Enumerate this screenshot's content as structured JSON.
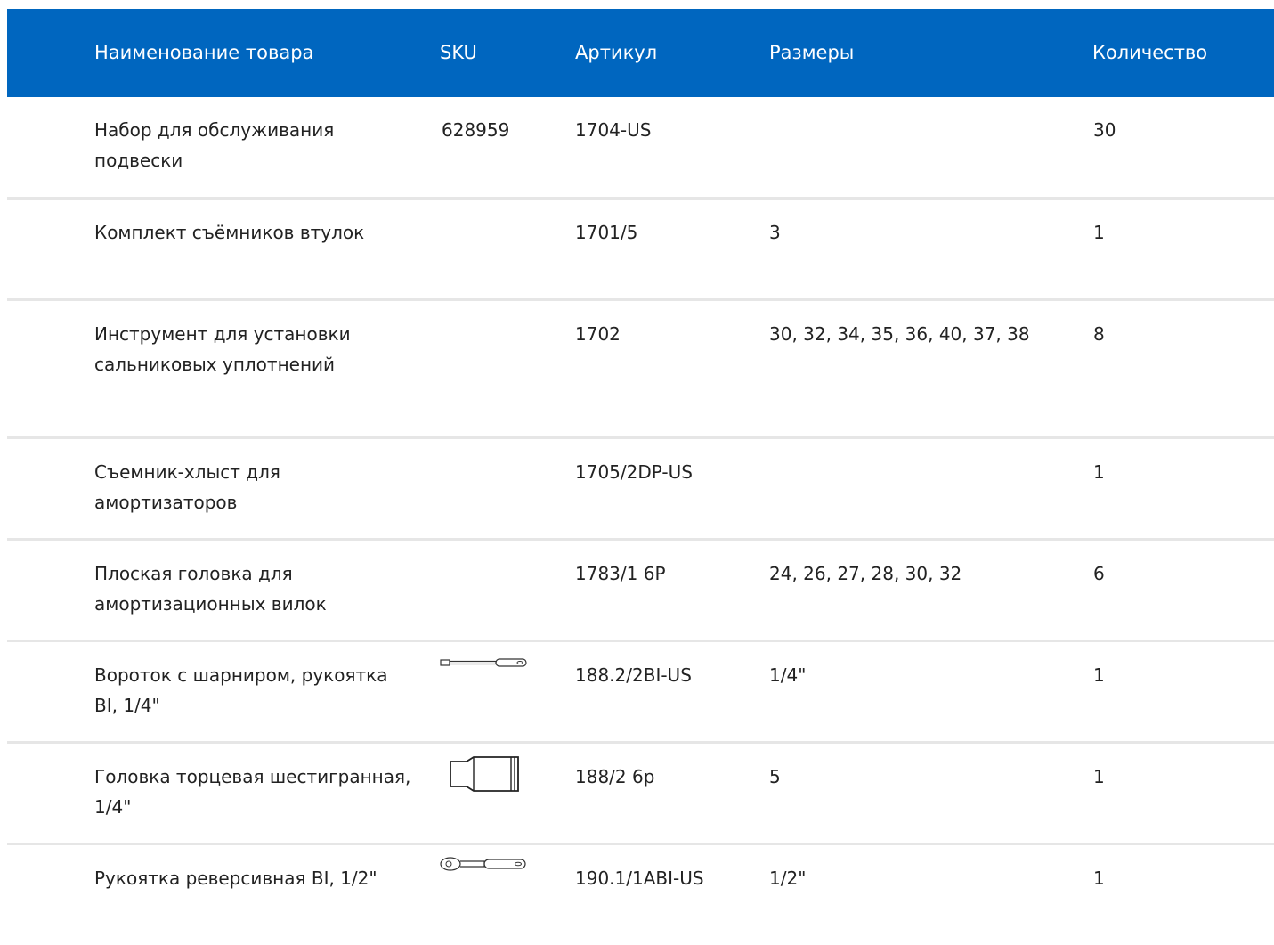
{
  "table": {
    "columns": {
      "name": "Наименование товара",
      "sku": "SKU",
      "article": "Артикул",
      "sizes": "Размеры",
      "qty": "Количество"
    },
    "rows": [
      {
        "name": "Набор для обслуживания подвески",
        "sku": "628959",
        "article": "1704-US",
        "sizes": "",
        "qty": "30"
      },
      {
        "name": "Комплект съёмников втулок",
        "sku": "",
        "article": "1701/5",
        "sizes": "3",
        "qty": "1"
      },
      {
        "name": "Инструмент для установки сальниковых уплотнений",
        "sku": "",
        "article": "1702",
        "sizes": "30, 32, 34, 35, 36, 40, 37, 38",
        "qty": "8"
      },
      {
        "name": "Съемник-хлыст для амортизаторов",
        "sku": "",
        "article": "1705/2DP-US",
        "sizes": "",
        "qty": "1"
      },
      {
        "name": "Плоская головка для амортизационных вилок",
        "sku": "",
        "article": "1783/1 6P",
        "sizes": "24, 26, 27, 28, 30, 32",
        "qty": "6"
      },
      {
        "name": "Вороток с шарниром, рукоятка BI, 1/4\"",
        "sku": "",
        "article": "188.2/2BI-US",
        "sizes": "1/4\"",
        "qty": "1",
        "thumb": "breaker-bar-icon"
      },
      {
        "name": "Головка торцевая шестигранная, 1/4\"",
        "sku": "",
        "article": "188/2 6р",
        "sizes": "5",
        "qty": "1",
        "thumb": "socket-icon"
      },
      {
        "name": "Рукоятка реверсивная BI, 1/2\"",
        "sku": "",
        "article": "190.1/1ABI-US",
        "sizes": "1/2\"",
        "qty": "1",
        "thumb": "ratchet-icon"
      }
    ]
  },
  "colors": {
    "header_bg": "#0066bf",
    "header_text": "#ffffff",
    "divider": "#e6e6e6",
    "text": "#222222"
  }
}
